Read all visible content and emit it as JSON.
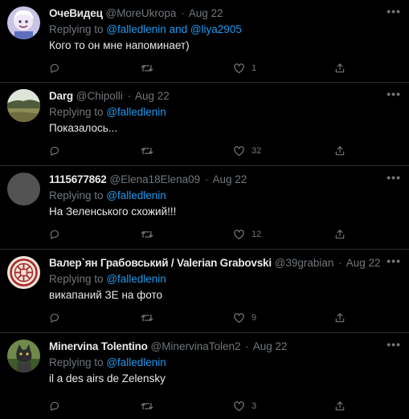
{
  "replying_to_label": "Replying to",
  "more_label": "•••",
  "tweets": [
    {
      "name": "ОчеВидец",
      "handle": "@MoreUkropa",
      "date": "Aug 22",
      "mentions": "@falledlenin and @liya2905",
      "text": "Кого то он мне напоминает)",
      "likes": "1",
      "avatar_icon": "smiling-person-avatar"
    },
    {
      "name": "Darg",
      "handle": "@Chipolli",
      "date": "Aug 22",
      "mentions": "@falledlenin",
      "text": "Показалось...",
      "likes": "32",
      "avatar_icon": "landscape-photo-avatar"
    },
    {
      "name": "1115677862",
      "handle": "@Elena18Elena09",
      "date": "Aug 22",
      "mentions": "@falledlenin",
      "text": "На Зеленського схожий!!!",
      "likes": "12",
      "avatar_icon": "default-gray-avatar"
    },
    {
      "name": "Валер`ян Грабовський / Valerian Grabovski",
      "handle": "@39grabian",
      "date": "Aug 22",
      "mentions": "@falledlenin",
      "text": "викапаний ЗЕ на фото",
      "likes": "9",
      "avatar_icon": "ornament-symbol-avatar"
    },
    {
      "name": "Minervina Tolentino",
      "handle": "@MinervinaTolen2",
      "date": "Aug 22",
      "mentions": "@falledlenin",
      "text": "il a des airs de Zelensky",
      "likes": "3",
      "avatar_icon": "cat-photo-avatar"
    }
  ]
}
